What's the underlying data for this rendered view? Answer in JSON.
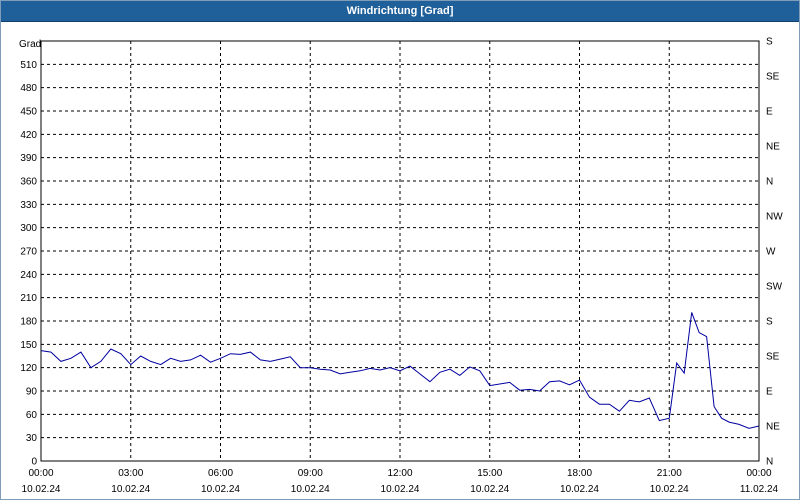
{
  "window": {
    "title": "Windrichtung [Grad]"
  },
  "colors": {
    "title_bg": "#1f5f9a",
    "series_line": "#0000a0",
    "grid": "#000000"
  },
  "chart_data": {
    "type": "line",
    "title": "Windrichtung [Grad]",
    "ylabel": "Grad",
    "ylim": [
      0,
      540
    ],
    "xlim": [
      "10.02.24 00:00",
      "11.02.24 00:00"
    ],
    "y_ticks": [
      0,
      30,
      60,
      90,
      120,
      150,
      180,
      210,
      240,
      270,
      300,
      330,
      360,
      390,
      420,
      450,
      480,
      510
    ],
    "x_ticks": [
      {
        "time": "00:00",
        "date": "10.02.24"
      },
      {
        "time": "03:00",
        "date": "10.02.24"
      },
      {
        "time": "06:00",
        "date": "10.02.24"
      },
      {
        "time": "09:00",
        "date": "10.02.24"
      },
      {
        "time": "12:00",
        "date": "10.02.24"
      },
      {
        "time": "15:00",
        "date": "10.02.24"
      },
      {
        "time": "18:00",
        "date": "10.02.24"
      },
      {
        "time": "21:00",
        "date": "10.02.24"
      },
      {
        "time": "00:00",
        "date": "11.02.24"
      }
    ],
    "right_axis_labels": [
      {
        "value": 0,
        "label": "N"
      },
      {
        "value": 45,
        "label": "NE"
      },
      {
        "value": 90,
        "label": "E"
      },
      {
        "value": 135,
        "label": "SE"
      },
      {
        "value": 180,
        "label": "S"
      },
      {
        "value": 225,
        "label": "SW"
      },
      {
        "value": 270,
        "label": "W"
      },
      {
        "value": 315,
        "label": "NW"
      },
      {
        "value": 360,
        "label": "N"
      },
      {
        "value": 405,
        "label": "NE"
      },
      {
        "value": 450,
        "label": "E"
      },
      {
        "value": 495,
        "label": "SE"
      },
      {
        "value": 540,
        "label": "S"
      }
    ],
    "grid": true,
    "series": [
      {
        "x": [
          "10.02.24 00:00",
          "10.02.24 00:20",
          "10.02.24 00:40",
          "10.02.24 01:00",
          "10.02.24 01:20",
          "10.02.24 01:40",
          "10.02.24 02:00",
          "10.02.24 02:20",
          "10.02.24 02:40",
          "10.02.24 03:00",
          "10.02.24 03:20",
          "10.02.24 03:40",
          "10.02.24 04:00",
          "10.02.24 04:20",
          "10.02.24 04:40",
          "10.02.24 05:00",
          "10.02.24 05:20",
          "10.02.24 05:40",
          "10.02.24 06:00",
          "10.02.24 06:20",
          "10.02.24 06:40",
          "10.02.24 07:00",
          "10.02.24 07:20",
          "10.02.24 07:40",
          "10.02.24 08:00",
          "10.02.24 08:20",
          "10.02.24 08:40",
          "10.02.24 09:00",
          "10.02.24 09:20",
          "10.02.24 09:40",
          "10.02.24 10:00",
          "10.02.24 10:20",
          "10.02.24 10:40",
          "10.02.24 11:00",
          "10.02.24 11:20",
          "10.02.24 11:40",
          "10.02.24 12:00",
          "10.02.24 12:20",
          "10.02.24 12:40",
          "10.02.24 13:00",
          "10.02.24 13:20",
          "10.02.24 13:40",
          "10.02.24 14:00",
          "10.02.24 14:20",
          "10.02.24 14:40",
          "10.02.24 15:00",
          "10.02.24 15:20",
          "10.02.24 15:40",
          "10.02.24 16:00",
          "10.02.24 16:20",
          "10.02.24 16:40",
          "10.02.24 17:00",
          "10.02.24 17:20",
          "10.02.24 17:40",
          "10.02.24 18:00",
          "10.02.24 18:20",
          "10.02.24 18:40",
          "10.02.24 19:00",
          "10.02.24 19:20",
          "10.02.24 19:40",
          "10.02.24 20:00",
          "10.02.24 20:20",
          "10.02.24 20:40",
          "10.02.24 21:00",
          "10.02.24 21:15",
          "10.02.24 21:30",
          "10.02.24 21:45",
          "10.02.24 22:00",
          "10.02.24 22:15",
          "10.02.24 22:30",
          "10.02.24 22:45",
          "10.02.24 23:00",
          "10.02.24 23:20",
          "10.02.24 23:40",
          "11.02.24 00:00"
        ],
        "y": [
          142,
          140,
          128,
          132,
          140,
          120,
          128,
          144,
          138,
          124,
          135,
          128,
          124,
          132,
          128,
          130,
          136,
          127,
          132,
          138,
          137,
          140,
          130,
          128,
          131,
          134,
          120,
          120,
          118,
          117,
          112,
          114,
          116,
          119,
          117,
          120,
          116,
          122,
          112,
          102,
          114,
          118,
          110,
          121,
          116,
          97,
          99,
          101,
          91,
          92,
          90,
          102,
          103,
          98,
          104,
          82,
          73,
          73,
          64,
          78,
          76,
          81,
          52,
          55,
          126,
          113,
          191,
          165,
          160,
          70,
          55,
          50,
          47,
          42,
          45
        ]
      }
    ]
  }
}
